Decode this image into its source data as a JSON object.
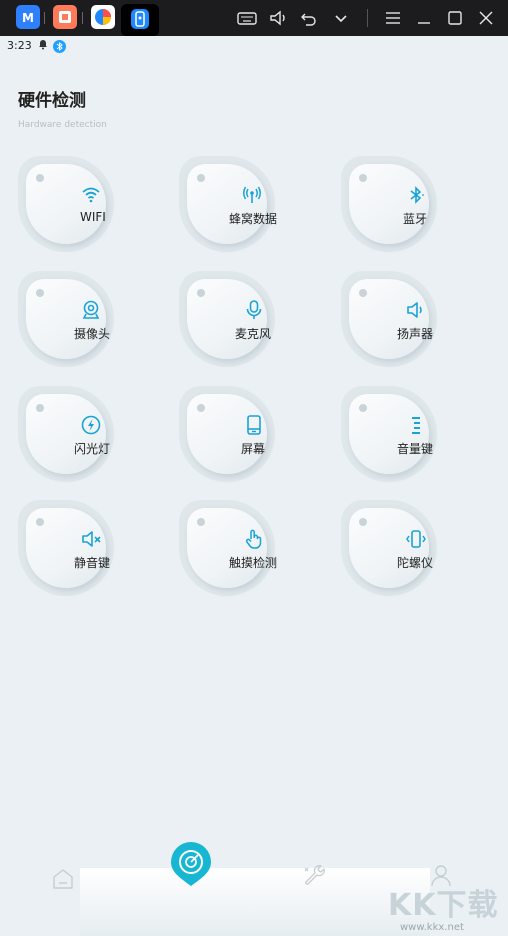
{
  "window": {
    "tabs": [
      {
        "name": "app-tab-1"
      },
      {
        "name": "app-tab-2"
      },
      {
        "name": "app-tab-3"
      },
      {
        "name": "app-tab-hardware",
        "active": true
      }
    ],
    "controls": [
      "keyboard-icon",
      "volume-icon",
      "back-icon",
      "chevron-down-icon",
      "menu-icon",
      "minimize-icon",
      "maximize-icon",
      "close-icon"
    ]
  },
  "status_bar": {
    "time": "3:23",
    "icons": [
      "bell-icon",
      "bluetooth-icon"
    ]
  },
  "header": {
    "title": "硬件检测",
    "subtitle": "Hardware detection"
  },
  "items": [
    {
      "label": "WIFI",
      "icon": "wifi-icon"
    },
    {
      "label": "蜂窝数据",
      "icon": "cellular-icon"
    },
    {
      "label": "蓝牙",
      "icon": "bluetooth-icon"
    },
    {
      "label": "摄像头",
      "icon": "camera-icon"
    },
    {
      "label": "麦克风",
      "icon": "microphone-icon"
    },
    {
      "label": "扬声器",
      "icon": "speaker-icon"
    },
    {
      "label": "闪光灯",
      "icon": "flash-icon"
    },
    {
      "label": "屏幕",
      "icon": "screen-icon"
    },
    {
      "label": "音量键",
      "icon": "volume-key-icon"
    },
    {
      "label": "静音键",
      "icon": "mute-icon"
    },
    {
      "label": "触摸检测",
      "icon": "touch-icon"
    },
    {
      "label": "陀螺仪",
      "icon": "gyroscope-icon"
    }
  ],
  "bottom_nav": {
    "items": [
      "home-icon",
      "detect-icon",
      "tools-icon",
      "user-icon"
    ]
  },
  "watermark": {
    "text": "KK下载",
    "url": "www.kkx.net"
  },
  "colors": {
    "accent": "#1aa3d6",
    "background": "#eaf0f3",
    "topbar": "#1c1c1e"
  }
}
